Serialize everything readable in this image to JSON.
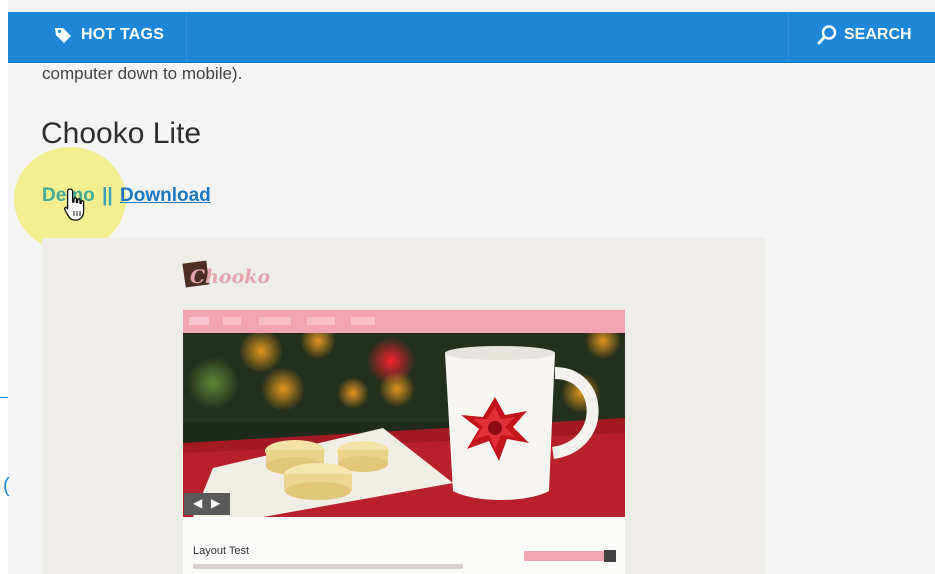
{
  "header": {
    "tags_label": "HOT TAGS",
    "search_label": "SEARCH",
    "color": "#1e87d8",
    "tags_icon": "tag-icon",
    "search_icon": "search-icon"
  },
  "article": {
    "intro_text": "computer down to mobile).",
    "theme_title": "Chooko Lite",
    "demo_link": "Demo",
    "separator": "||",
    "download_link": "Download"
  },
  "preview": {
    "logo_text": "Chooko",
    "post_title": "Layout Test"
  },
  "left_glyph": "("
}
